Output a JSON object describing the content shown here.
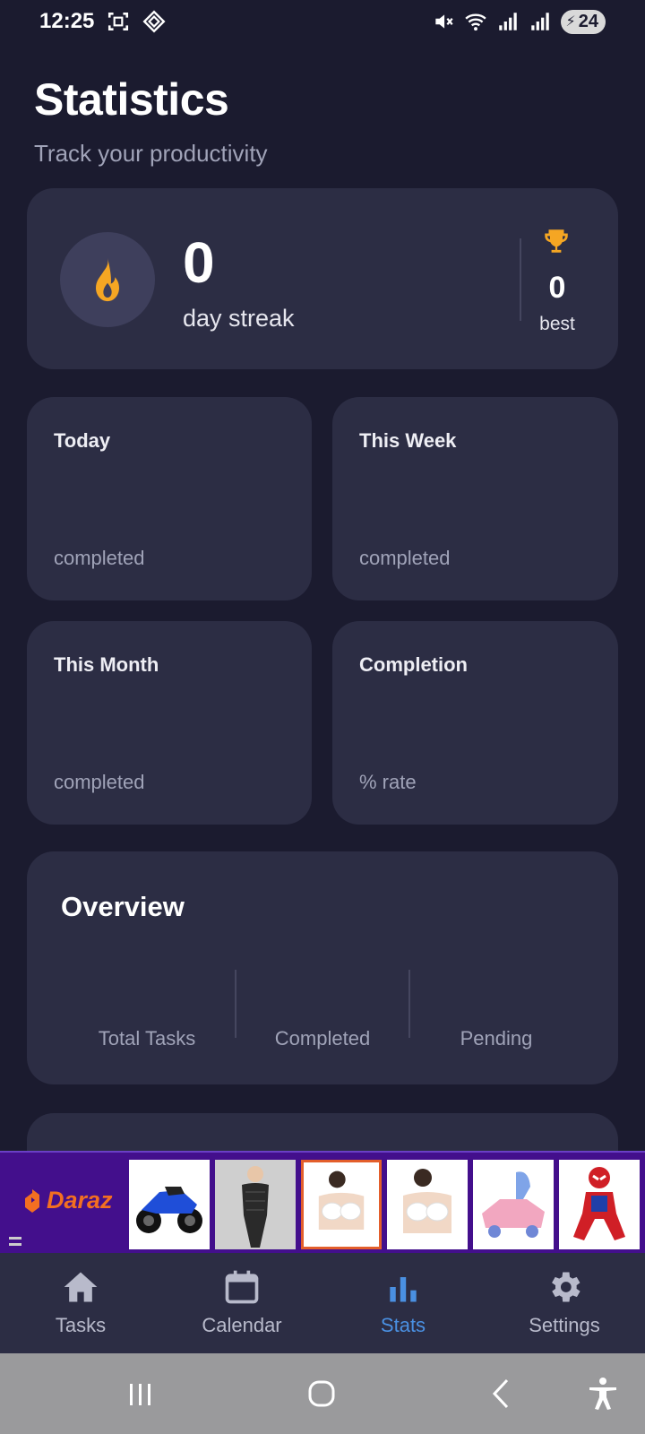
{
  "status_bar": {
    "time": "12:25",
    "battery": "24",
    "icons": [
      "screenshot-icon",
      "nfc-icon",
      "mute-icon",
      "wifi-icon",
      "signal-icon",
      "signal-icon",
      "battery-charging-icon"
    ]
  },
  "header": {
    "title": "Statistics",
    "subtitle": "Track your productivity"
  },
  "streak": {
    "icon": "flame-icon",
    "value": "0",
    "label": "day streak",
    "best_icon": "trophy-icon",
    "best_value": "0",
    "best_label": "best"
  },
  "stat_cards": [
    {
      "title": "Today",
      "subtitle": "completed"
    },
    {
      "title": "This Week",
      "subtitle": "completed"
    },
    {
      "title": "This Month",
      "subtitle": "completed"
    },
    {
      "title": "Completion",
      "subtitle": "% rate"
    }
  ],
  "overview": {
    "title": "Overview",
    "columns": [
      "Total Tasks",
      "Completed",
      "Pending"
    ]
  },
  "ad": {
    "brand": "Daraz",
    "thumbnails": [
      "motorbike",
      "bodysuit",
      "bra",
      "bra",
      "toy-car",
      "spiderman-costume"
    ]
  },
  "bottom_nav": {
    "items": [
      {
        "label": "Tasks",
        "icon": "home-icon"
      },
      {
        "label": "Calendar",
        "icon": "calendar-icon"
      },
      {
        "label": "Stats",
        "icon": "bar-chart-icon",
        "active": true
      },
      {
        "label": "Settings",
        "icon": "gear-icon"
      }
    ]
  },
  "colors": {
    "background": "#1b1b2f",
    "card": "#2c2d44",
    "accent": "#4a90e2",
    "flame": "#f5a623",
    "ad_background": "#430f8c"
  }
}
